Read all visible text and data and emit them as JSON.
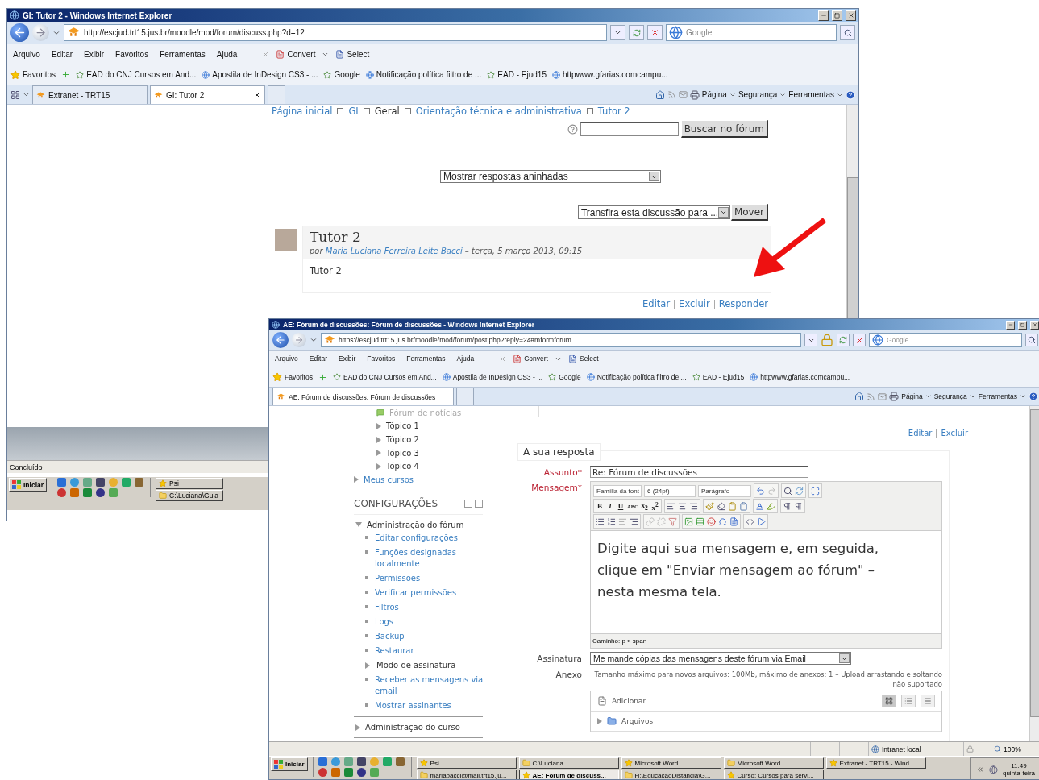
{
  "window_main": {
    "title": "GI: Tutor 2 - Windows Internet Explorer",
    "address": "http://escjud.trt15.jus.br/moodle/mod/forum/discuss.php?d=12",
    "secure": false,
    "search_placeholder": "Google",
    "menu": [
      "Arquivo",
      "Editar",
      "Exibir",
      "Favoritos",
      "Ferramentas",
      "Ajuda"
    ],
    "toolbar": [
      "Convert",
      "Select"
    ],
    "favorites_label": "Favoritos",
    "favorites": [
      "EAD do CNJ Cursos em And...",
      "Apostila de InDesign CS3 - ...",
      "Google",
      "Notificação política filtro de ...",
      "EAD - Ejud15",
      "httpwww.gfarias.comcampu..."
    ],
    "tabs": [
      {
        "label": "Extranet - TRT15",
        "selected": false
      },
      {
        "label": "GI: Tutor 2",
        "selected": true
      }
    ],
    "commands": [
      "Página",
      "Segurança",
      "Ferramentas"
    ],
    "breadcrumb": [
      {
        "label": "Página inicial",
        "link": true
      },
      {
        "label": "GI",
        "link": true
      },
      {
        "label": "Geral",
        "link": false
      },
      {
        "label": "Orientação técnica e administrativa",
        "link": true
      },
      {
        "label": "Tutor 2",
        "link": true
      }
    ],
    "search_button": "Buscar no fórum",
    "display_mode": "Mostrar respostas aninhadas",
    "move_select": "Transfira esta discussão para ...",
    "move_button": "Mover",
    "post": {
      "title": "Tutor 2",
      "by": "por",
      "author": "Maria Luciana Ferreira Leite Bacci",
      "date": "– terça, 5 março 2013, 09:15",
      "body": "Tutor 2"
    },
    "post_actions": [
      "Editar",
      "Excluir",
      "Responder"
    ],
    "status": "Concluído",
    "taskbar": {
      "start": "Iniciar",
      "items": [
        {
          "label": "Psi",
          "selected": false
        },
        {
          "label": "C:\\Luciana\\Guia",
          "selected": false
        }
      ]
    }
  },
  "window_reply": {
    "title": "AE: Fórum de discussões: Fórum de discussões - Windows Internet Explorer",
    "address": "https://escjud.trt15.jus.br/moodle/mod/forum/post.php?reply=24#mformforum",
    "secure": true,
    "search_placeholder": "Google",
    "menu": [
      "Arquivo",
      "Editar",
      "Exibir",
      "Favoritos",
      "Ferramentas",
      "Ajuda"
    ],
    "toolbar": [
      "Convert",
      "Select"
    ],
    "favorites_label": "Favoritos",
    "favorites": [
      "EAD do CNJ Cursos em And...",
      "Apostila de InDesign CS3 - ...",
      "Google",
      "Notificação política filtro de ...",
      "EAD - Ejud15",
      "httpwww.gfarias.comcampu..."
    ],
    "tabs": [
      {
        "label": "AE: Fórum de discussões: Fórum de discussões",
        "selected": true
      }
    ],
    "commands": [
      "Página",
      "Segurança",
      "Ferramentas"
    ],
    "navigation": [
      {
        "label": "Fórum de notícias",
        "kind": "forum"
      },
      {
        "label": "Tópico 1",
        "kind": "section"
      },
      {
        "label": "Tópico 2",
        "kind": "section"
      },
      {
        "label": "Tópico 3",
        "kind": "section"
      },
      {
        "label": "Tópico 4",
        "kind": "section"
      }
    ],
    "my_courses": "Meus cursos",
    "settings": {
      "title": "CONFIGURAÇÕES",
      "tree": [
        {
          "label": "Administração do fórum",
          "expanded": true,
          "children": [
            {
              "label": "Editar configurações",
              "kind": "link"
            },
            {
              "label": "Funções designadas localmente",
              "kind": "link"
            },
            {
              "label": "Permissões",
              "kind": "link"
            },
            {
              "label": "Verificar permissões",
              "kind": "link"
            },
            {
              "label": "Filtros",
              "kind": "link"
            },
            {
              "label": "Logs",
              "kind": "link"
            },
            {
              "label": "Backup",
              "kind": "link"
            },
            {
              "label": "Restaurar",
              "kind": "link"
            },
            {
              "label": "Modo de assinatura",
              "kind": "branch"
            },
            {
              "label": "Receber as mensagens via email",
              "kind": "link"
            },
            {
              "label": "Mostrar assinantes",
              "kind": "link"
            }
          ]
        },
        {
          "label": "Administração do curso",
          "expanded": false
        }
      ]
    },
    "post_actions": [
      "Editar",
      "Excluir"
    ],
    "form": {
      "legend": "A sua resposta",
      "subject_label": "Assunto*",
      "subject": "Re: Fórum de discussões",
      "message_label": "Mensagem*",
      "font_family": "Família da font",
      "font_size": "6 (24pt)",
      "format": "Parágrafo",
      "format_buttons": [
        "B",
        "I",
        "U",
        "ABC",
        "x$_{2}$",
        "x$^{2}$"
      ],
      "message": "Digite aqui sua mensagem e, em seguida, clique em \"Enviar mensagem ao fórum\" – nesta mesma tela.",
      "path": "Caminho: p » span",
      "subscription_label": "Assinatura",
      "subscription": "Me mande cópias das mensagens deste fórum via Email",
      "attachment_label": "Anexo",
      "attachment_hint": "Tamanho máximo para novos arquivos: 100Mb, máximo de anexos: 1 – Upload arrastando e soltando não suportado",
      "add_files": "Adicionar...",
      "view_modes": [
        {
          "kind": "icons",
          "selected": true
        },
        {
          "kind": "list",
          "selected": false
        },
        {
          "kind": "tree",
          "selected": false
        }
      ],
      "folder": "Arquivos"
    },
    "status": {
      "zone": "Intranet local",
      "zoom": "100%"
    },
    "taskbar": {
      "start": "Iniciar",
      "items": [
        {
          "label": "Psi",
          "selected": false
        },
        {
          "label": "C:\\Luciana",
          "selected": false
        },
        {
          "label": "Microsoft Word",
          "selected": false
        },
        {
          "label": "Microsoft Word",
          "selected": false
        },
        {
          "label": "Extranet - TRT15 - Wind...",
          "selected": false
        },
        {
          "label": "mariabacci@mail.trt15.ju...",
          "selected": false
        },
        {
          "label": "AE: Fórum de discuss...",
          "selected": true
        },
        {
          "label": "H:\\EducacaoDistancia\\G...",
          "selected": false
        },
        {
          "label": "Curso: Cursos para servi...",
          "selected": false
        }
      ],
      "clock": "11:49",
      "day": "quinta-feira"
    }
  }
}
